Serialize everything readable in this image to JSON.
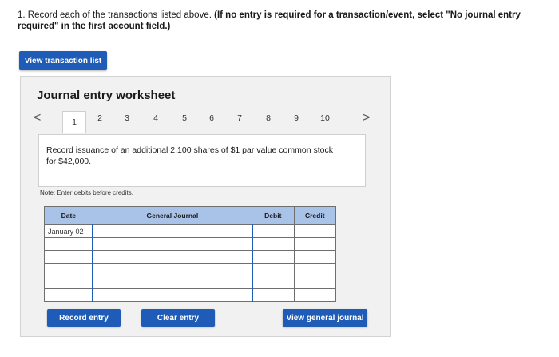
{
  "question": {
    "normal": "1. Record each of the transactions listed above. ",
    "bold": "(If no entry is required for a transaction/event, select \"No journal entry required\" in the first account field.)"
  },
  "buttons": {
    "view_transaction_list": "View transaction list",
    "record_entry": "Record entry",
    "clear_entry": "Clear entry",
    "view_general_journal": "View general journal"
  },
  "worksheet": {
    "title": "Journal entry worksheet",
    "prev_arrow": "<",
    "next_arrow": ">",
    "tabs": [
      "1",
      "2",
      "3",
      "4",
      "5",
      "6",
      "7",
      "8",
      "9",
      "10"
    ],
    "active_tab": 1,
    "description": "Record issuance of an additional 2,100 shares of $1 par value common stock for $42,000.",
    "note": "Note: Enter debits before credits."
  },
  "journal_table": {
    "headers": {
      "date": "Date",
      "account": "General Journal",
      "debit": "Debit",
      "credit": "Credit"
    },
    "rows": [
      {
        "date": "January 02",
        "account": "",
        "debit": "",
        "credit": ""
      },
      {
        "date": "",
        "account": "",
        "debit": "",
        "credit": ""
      },
      {
        "date": "",
        "account": "",
        "debit": "",
        "credit": ""
      },
      {
        "date": "",
        "account": "",
        "debit": "",
        "credit": ""
      },
      {
        "date": "",
        "account": "",
        "debit": "",
        "credit": ""
      },
      {
        "date": "",
        "account": "",
        "debit": "",
        "credit": ""
      }
    ]
  },
  "colors": {
    "button_blue": "#1f5cb8",
    "header_blue": "#a9c3e8",
    "panel_gray": "#f1f1f1"
  }
}
